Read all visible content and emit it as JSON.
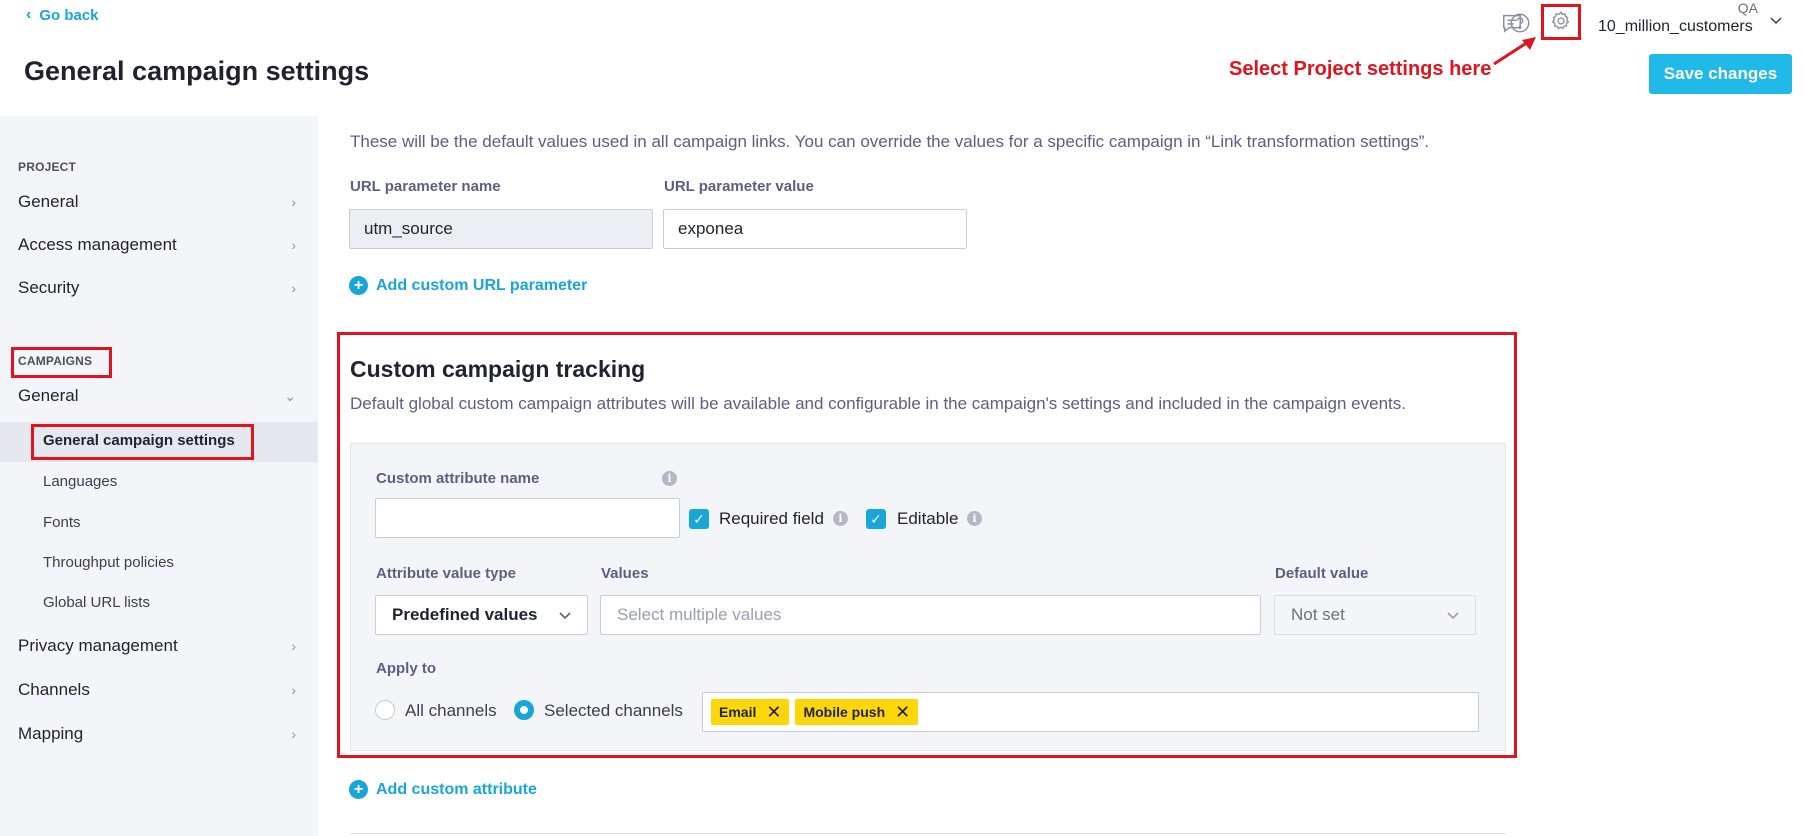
{
  "header": {
    "go_back": "Go back",
    "page_title": "General campaign settings",
    "project_top": "QA",
    "project_name": "10_million_customers",
    "annotation": "Select Project settings here",
    "save_label": "Save changes",
    "icons": [
      "chat-icon",
      "help-icon",
      "gear-icon",
      "chevron-down-icon"
    ]
  },
  "sidebar": {
    "section_project": "PROJECT",
    "project_items": [
      {
        "label": "General"
      },
      {
        "label": "Access management"
      },
      {
        "label": "Security"
      }
    ],
    "section_campaigns": "CAMPAIGNS",
    "campaigns_general": "General",
    "campaigns_sub": [
      {
        "label": "General campaign settings",
        "active": true
      },
      {
        "label": "Languages"
      },
      {
        "label": "Fonts"
      },
      {
        "label": "Throughput policies"
      },
      {
        "label": "Global URL lists"
      }
    ],
    "other_items": [
      {
        "label": "Privacy management"
      },
      {
        "label": "Channels"
      },
      {
        "label": "Mapping"
      }
    ]
  },
  "url_params": {
    "intro": "These will be the default values used in all campaign links. You can override the values for a specific campaign in “Link transformation settings”.",
    "name_label": "URL parameter name",
    "value_label": "URL parameter value",
    "name_value": "utm_source",
    "value_value": "exponea",
    "add_label": "Add custom URL parameter"
  },
  "custom_tracking": {
    "title": "Custom campaign tracking",
    "description": "Default global custom campaign attributes will be available and configurable in the campaign's settings and included in the campaign events.",
    "attr_name_label": "Custom attribute name",
    "attr_name_value": "",
    "required_label": "Required field",
    "editable_label": "Editable",
    "value_type_label": "Attribute value type",
    "value_type_selected": "Predefined values",
    "values_label": "Values",
    "values_placeholder": "Select multiple values",
    "default_label": "Default value",
    "default_selected": "Not set",
    "apply_label": "Apply to",
    "radio_all": "All channels",
    "radio_selected": "Selected channels",
    "chips": [
      "Email",
      "Mobile push"
    ],
    "add_attribute_label": "Add custom attribute"
  },
  "colors": {
    "accent": "#1aa5d8",
    "save_button": "#21b9e8",
    "annotation_red": "#e0141e",
    "chip_yellow": "#ffd60a",
    "sidebar_bg": "#f4f5f8"
  }
}
